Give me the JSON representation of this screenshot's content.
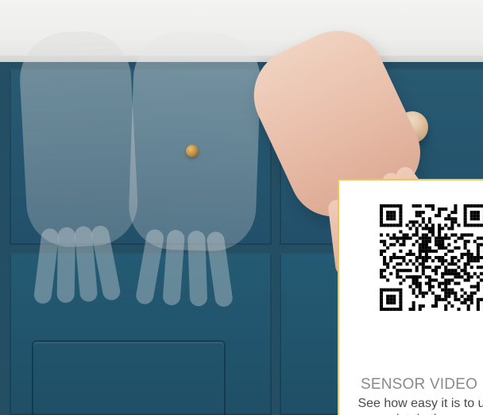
{
  "qr_card": {
    "title": "SENSOR VIDEO",
    "description": "See how easy it is to use & maintain the sensor",
    "accent_color": "#F1C55A",
    "icon": "qr-code-icon"
  }
}
